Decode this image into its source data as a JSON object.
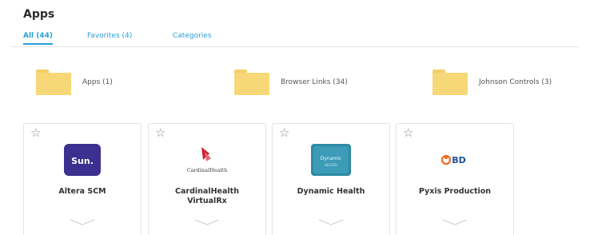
{
  "header": {
    "title": "Apps"
  },
  "tabs": [
    {
      "label": "All (44)"
    },
    {
      "label": "Favorites (4)"
    },
    {
      "label": "Categories"
    }
  ],
  "folders": [
    {
      "label": "Apps (1)"
    },
    {
      "label": "Browser Links (34)"
    },
    {
      "label": "Johnson Controls (3)"
    }
  ],
  "apps": [
    {
      "name": "Altera SCM",
      "logo_text": "Sun.",
      "icon": "altera-logo",
      "favorite": false
    },
    {
      "name": "CardinalHealth VirtualRx",
      "logo_text": "CardinalHealth",
      "icon": "cardinal-health-logo",
      "favorite": false
    },
    {
      "name": "Dynamic Health",
      "logo_text": "Dynamic",
      "logo_subtext": "HEALTH",
      "icon": "dynamic-health-logo",
      "favorite": false
    },
    {
      "name": "Pyxis Production",
      "logo_text": "BD",
      "icon": "bd-logo",
      "favorite": false
    }
  ],
  "colors": {
    "accent": "#2a9fd8",
    "folder": "#f7d878",
    "sun_logo": "#3b2f8f",
    "cardinal_red": "#d0202f",
    "dynamic_teal": "#2f8aa5",
    "bd_orange": "#f26a21",
    "bd_blue": "#1e4e9a"
  }
}
